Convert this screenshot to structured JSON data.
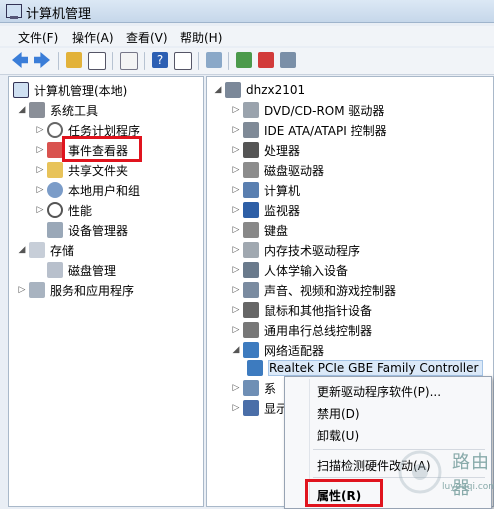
{
  "window": {
    "title": "计算机管理"
  },
  "menu": {
    "file": "文件(F)",
    "action": "操作(A)",
    "view": "查看(V)",
    "help": "帮助(H)"
  },
  "left_tree": {
    "root": "计算机管理(本地)",
    "system_tools": "系统工具",
    "task_scheduler": "任务计划程序",
    "event_viewer": "事件查看器",
    "shared_folders": "共享文件夹",
    "local_users": "本地用户和组",
    "performance": "性能",
    "device_manager": "设备管理器",
    "storage": "存储",
    "disk_management": "磁盘管理",
    "services_apps": "服务和应用程序"
  },
  "device_tree": {
    "computer_name": "dhzx2101",
    "categories": [
      "DVD/CD-ROM 驱动器",
      "IDE ATA/ATAPI 控制器",
      "处理器",
      "磁盘驱动器",
      "计算机",
      "监视器",
      "键盘",
      "内存技术驱动程序",
      "人体学输入设备",
      "声音、视频和游戏控制器",
      "鼠标和其他指针设备",
      "通用串行总线控制器",
      "网络适配器"
    ],
    "network_device": "Realtek PCIe GBE Family Controller",
    "partial_1": "系",
    "partial_2": "显示"
  },
  "context_menu": {
    "update_driver": "更新驱动程序软件(P)...",
    "disable": "禁用(D)",
    "uninstall": "卸载(U)",
    "scan": "扫描检测硬件改动(A)",
    "properties": "属性(R)"
  },
  "watermark": {
    "text": "路由器",
    "sub": "luyouqi.com"
  },
  "colors": {
    "highlight": "#e0141e",
    "selection": "#dbe9f8"
  }
}
